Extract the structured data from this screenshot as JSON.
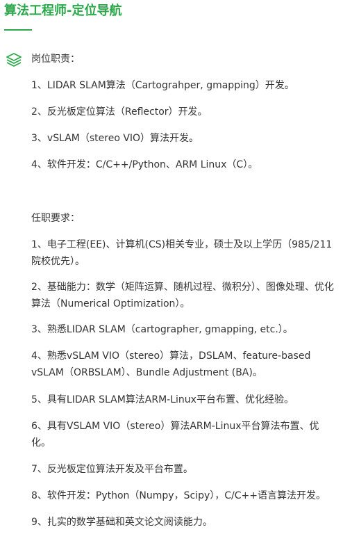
{
  "title": "算法工程师-定位导航",
  "duties": {
    "icon": "layers-icon",
    "heading": "岗位职责：",
    "items": [
      "1、LIDAR SLAM算法（Cartograhper, gmapping）开发。",
      "2、反光板定位算法（Reflector）开发。",
      "3、vSLAM（stereo VIO）算法开发。",
      "4、软件开发：C/C++/Python、ARM Linux（C）。"
    ]
  },
  "requirements": {
    "heading": "任职要求：",
    "items": [
      "1、电子工程(EE)、计算机(CS)相关专业，硕士及以上学历（985/211院校优先）。",
      "2、基础能力：数学（矩阵运算、随机过程、微积分）、图像处理、优化算法（Numerical Optimization）。",
      "3、熟悉LIDAR SLAM（cartographer, gmapping, etc.）。",
      "4、熟悉vSLAM VIO（stereo）算法，DSLAM、feature-based vSLAM（ORBSLAM）、Bundle Adjustment (BA)。",
      "5、具有LIDAR SLAM算法ARM-Linux平台布置、优化经验。",
      "6、具有VSLAM VIO（stereo）算法ARM-Linux平台算法布置、优化。",
      "7、反光板定位算法开发及平台布置。",
      "8、软件开发：Python（Numpy，Scipy），C/C++语言算法开发。",
      "9、扎实的数学基础和英文论文阅读能力。"
    ]
  },
  "colors": {
    "accent": "#2aa84a",
    "text": "#333333"
  }
}
